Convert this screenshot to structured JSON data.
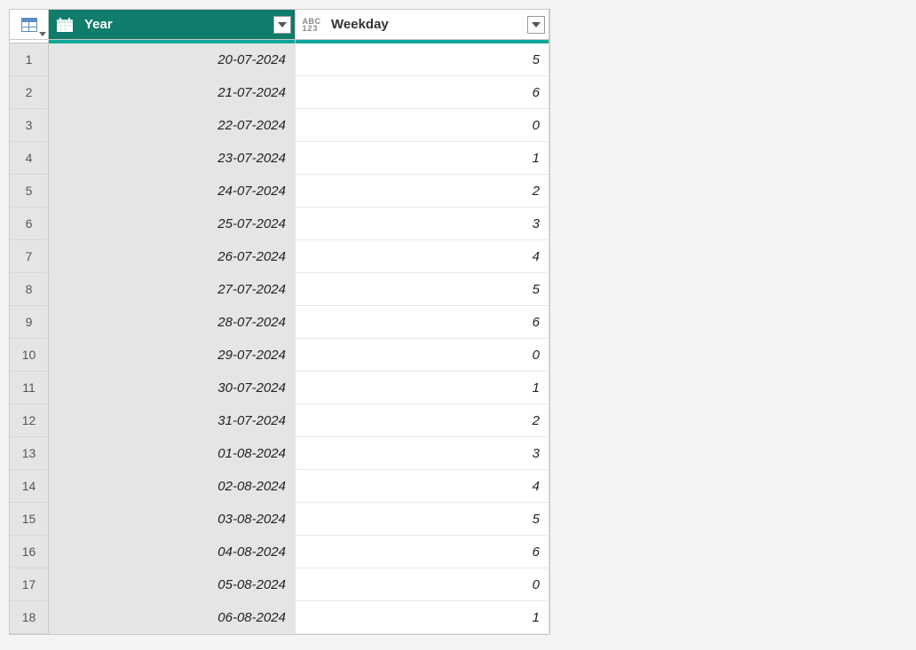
{
  "columns": {
    "year": {
      "label": "Year"
    },
    "weekday": {
      "label": "Weekday"
    }
  },
  "rows": [
    {
      "n": "1",
      "year": "20-07-2024",
      "weekday": "5"
    },
    {
      "n": "2",
      "year": "21-07-2024",
      "weekday": "6"
    },
    {
      "n": "3",
      "year": "22-07-2024",
      "weekday": "0"
    },
    {
      "n": "4",
      "year": "23-07-2024",
      "weekday": "1"
    },
    {
      "n": "5",
      "year": "24-07-2024",
      "weekday": "2"
    },
    {
      "n": "6",
      "year": "25-07-2024",
      "weekday": "3"
    },
    {
      "n": "7",
      "year": "26-07-2024",
      "weekday": "4"
    },
    {
      "n": "8",
      "year": "27-07-2024",
      "weekday": "5"
    },
    {
      "n": "9",
      "year": "28-07-2024",
      "weekday": "6"
    },
    {
      "n": "10",
      "year": "29-07-2024",
      "weekday": "0"
    },
    {
      "n": "11",
      "year": "30-07-2024",
      "weekday": "1"
    },
    {
      "n": "12",
      "year": "31-07-2024",
      "weekday": "2"
    },
    {
      "n": "13",
      "year": "01-08-2024",
      "weekday": "3"
    },
    {
      "n": "14",
      "year": "02-08-2024",
      "weekday": "4"
    },
    {
      "n": "15",
      "year": "03-08-2024",
      "weekday": "5"
    },
    {
      "n": "16",
      "year": "04-08-2024",
      "weekday": "6"
    },
    {
      "n": "17",
      "year": "05-08-2024",
      "weekday": "0"
    },
    {
      "n": "18",
      "year": "06-08-2024",
      "weekday": "1"
    }
  ],
  "icon_text": {
    "abc": "ABC",
    "nums": "123"
  }
}
